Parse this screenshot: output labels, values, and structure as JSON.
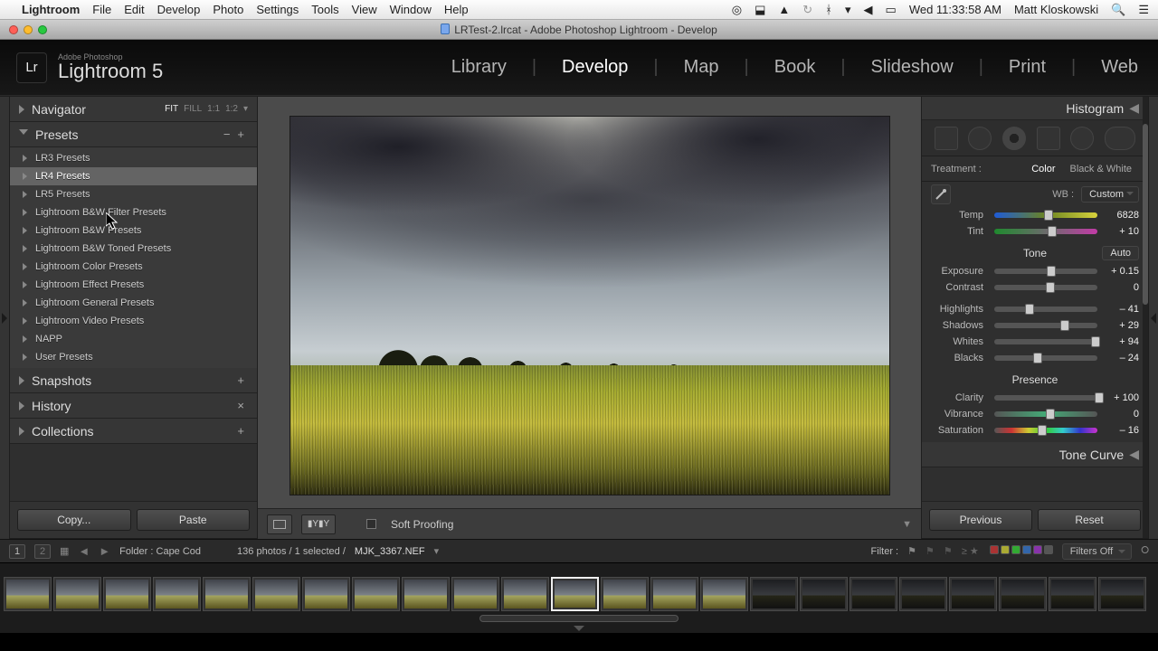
{
  "macbar": {
    "app": "Lightroom",
    "menus": [
      "File",
      "Edit",
      "Develop",
      "Photo",
      "Settings",
      "Tools",
      "View",
      "Window",
      "Help"
    ],
    "clock": "Wed 11:33:58 AM",
    "user": "Matt Kloskowski"
  },
  "window": {
    "title": "LRTest-2.lrcat - Adobe Photoshop Lightroom - Develop"
  },
  "header": {
    "suite": "Adobe Photoshop",
    "product": "Lightroom 5",
    "logo": "Lr",
    "modules": [
      "Library",
      "Develop",
      "Map",
      "Book",
      "Slideshow",
      "Print",
      "Web"
    ],
    "active_module": "Develop"
  },
  "left": {
    "navigator": {
      "title": "Navigator",
      "zoom": [
        "FIT",
        "FILL",
        "1:1",
        "1:2"
      ],
      "zoom_active": "FIT"
    },
    "presets": {
      "title": "Presets",
      "folders": [
        "LR3 Presets",
        "LR4 Presets",
        "LR5 Presets",
        "Lightroom B&W Filter Presets",
        "Lightroom B&W Presets",
        "Lightroom B&W Toned Presets",
        "Lightroom Color Presets",
        "Lightroom Effect Presets",
        "Lightroom General Presets",
        "Lightroom Video Presets",
        "NAPP",
        "User Presets"
      ],
      "selected": "LR4 Presets"
    },
    "snapshots": "Snapshots",
    "history": "History",
    "collections": "Collections",
    "copy": "Copy...",
    "paste": "Paste"
  },
  "center": {
    "soft_proofing": "Soft Proofing"
  },
  "right": {
    "histogram": "Histogram",
    "treatment": {
      "label": "Treatment :",
      "color": "Color",
      "bw": "Black & White"
    },
    "wb": {
      "label": "WB :",
      "value": "Custom"
    },
    "temp": {
      "label": "Temp",
      "value": "6828"
    },
    "tint": {
      "label": "Tint",
      "value": "+ 10"
    },
    "tone": {
      "label": "Tone",
      "auto": "Auto"
    },
    "exposure": {
      "label": "Exposure",
      "value": "+ 0.15"
    },
    "contrast": {
      "label": "Contrast",
      "value": "0"
    },
    "highlights": {
      "label": "Highlights",
      "value": "– 41"
    },
    "shadows": {
      "label": "Shadows",
      "value": "+ 29"
    },
    "whites": {
      "label": "Whites",
      "value": "+ 94"
    },
    "blacks": {
      "label": "Blacks",
      "value": "– 24"
    },
    "presence": "Presence",
    "clarity": {
      "label": "Clarity",
      "value": "+ 100"
    },
    "vibrance": {
      "label": "Vibrance",
      "value": "0"
    },
    "saturation": {
      "label": "Saturation",
      "value": "– 16"
    },
    "tonecurve": "Tone Curve",
    "previous": "Previous",
    "reset": "Reset"
  },
  "footer": {
    "pages": [
      "1",
      "2"
    ],
    "folder": "Folder : Cape Cod",
    "count": "136 photos / 1 selected /",
    "file": "MJK_3367.NEF",
    "filter_label": "Filter :",
    "filters_off": "Filters Off",
    "thumbs": 23,
    "selected_thumb": 11
  }
}
